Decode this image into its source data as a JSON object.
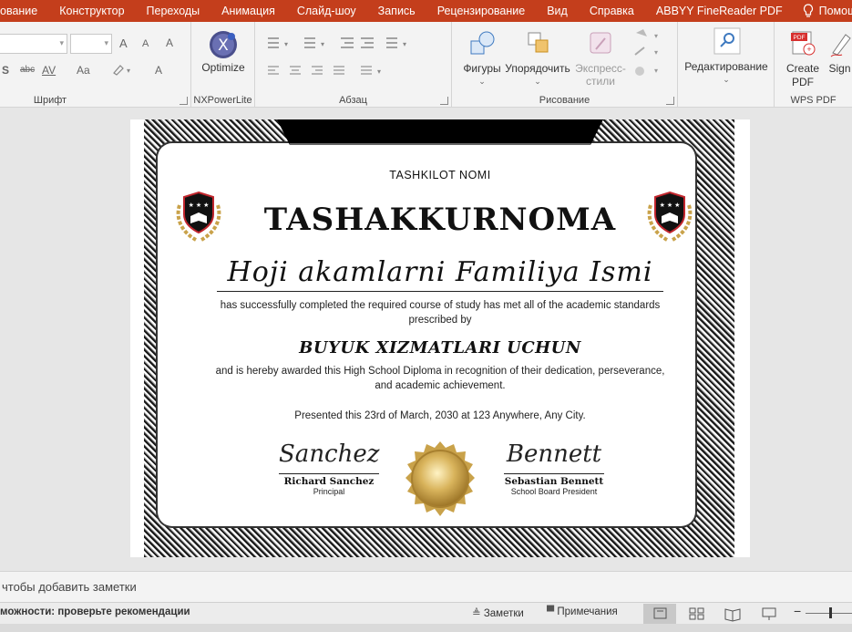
{
  "menu": {
    "tabs": [
      "ование",
      "Конструктор",
      "Переходы",
      "Анимация",
      "Слайд-шоу",
      "Запись",
      "Рецензирование",
      "Вид",
      "Справка",
      "ABBYY FineReader PDF"
    ],
    "help": "Помощ"
  },
  "ribbon": {
    "groups": {
      "font": "Шрифт",
      "nxpowerlite": "NXPowerLite",
      "paragraph": "Абзац",
      "drawing": "Рисование",
      "wps": "WPS PDF"
    },
    "buttons": {
      "optimize": "Optimize",
      "shapes": "Фигуры",
      "arrange": "Упорядочить",
      "quick_styles_1": "Экспресс-",
      "quick_styles_2": "стили",
      "editing": "Редактирование",
      "create_pdf_1": "Create",
      "create_pdf_2": "PDF",
      "sign": "Sign",
      "pdf_badge": "PDF"
    },
    "font_small": {
      "grow": "A",
      "shrink": "A",
      "clear": "A",
      "strike": "abc",
      "spacing": "AV",
      "case": "Aa",
      "color": "A",
      "s": "S"
    },
    "nx_logo": "X"
  },
  "slide": {
    "org": "TASHKILOT NOMI",
    "title": "TASHAKKURNOMA",
    "recipient": "Hoji akamlarni Familiya Ismi",
    "text1": "has successfully completed the required course of study has met all of the academic standards prescribed by",
    "award": "BUYUK XIZMATLARI UCHUN",
    "text2": "and is hereby awarded this High School Diploma in recognition of their dedication, perseverance, and academic achievement.",
    "presented": "Presented this 23rd of March, 2030 at  123 Anywhere, Any City.",
    "signer1": {
      "script": "Sanchez",
      "name": "Richard Sanchez",
      "role": "Principal"
    },
    "signer2": {
      "script": "Bennett",
      "name": "Sebastian Bennett",
      "role": "School Board President"
    }
  },
  "notes": {
    "placeholder": "чтобы добавить заметки"
  },
  "status": {
    "accessibility": "можности: проверьте рекомендации",
    "notes_btn": "Заметки",
    "comments_btn": "Примечания",
    "zoom_minus": "−"
  },
  "colors": {
    "accent": "#c43e1c",
    "gold": "#c9a24a"
  }
}
